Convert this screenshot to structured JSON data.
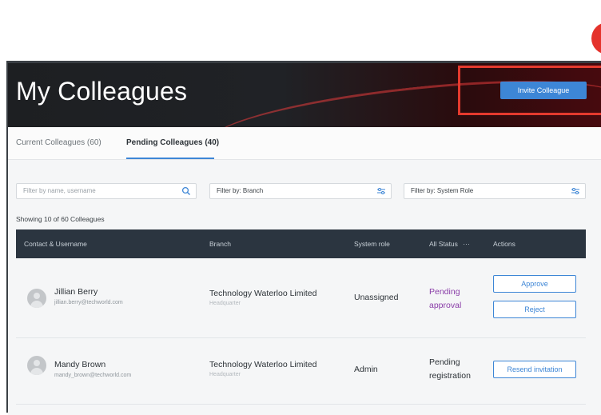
{
  "header": {
    "title": "My Colleagues",
    "invite_label": "Invite Colleague"
  },
  "tabs": [
    {
      "label": "Current Colleagues (60)",
      "active": false
    },
    {
      "label": "Pending Colleagues (40)",
      "active": true
    }
  ],
  "filters": {
    "search_placeholder": "Filter by name, username",
    "branch_label": "Filter by: Branch",
    "role_label": "Filter by: System Role"
  },
  "summary": "Showing 10 of 60 Colleagues",
  "table": {
    "headers": [
      "Contact & Username",
      "Branch",
      "System role",
      "All Status",
      "Actions"
    ],
    "status_menu_glyph": "···",
    "rows": [
      {
        "name": "Jillian Berry",
        "email": "jillian.berry@techworld.com",
        "branch": "Technology Waterloo Limited",
        "branch_sub": "Headquarter",
        "role": "Unassigned",
        "status": [
          "Pending",
          "approval"
        ],
        "actions": [
          "Approve",
          "Reject"
        ]
      },
      {
        "name": "Mandy Brown",
        "email": "mandy_brown@techworld.com",
        "branch": "Technology Waterloo Limited",
        "branch_sub": "Headquarter",
        "role": "Admin",
        "status": [
          "Pending",
          "registration"
        ],
        "actions": [
          "Resend invitation"
        ]
      }
    ]
  },
  "colors": {
    "accent": "#3d86d6",
    "highlight": "#e53a2e",
    "pending_approval": "#8a3ea8",
    "table_header": "#2b3540"
  },
  "icons": {
    "search": "search-icon",
    "filter": "sliders-icon",
    "avatar": "user-avatar-icon"
  }
}
